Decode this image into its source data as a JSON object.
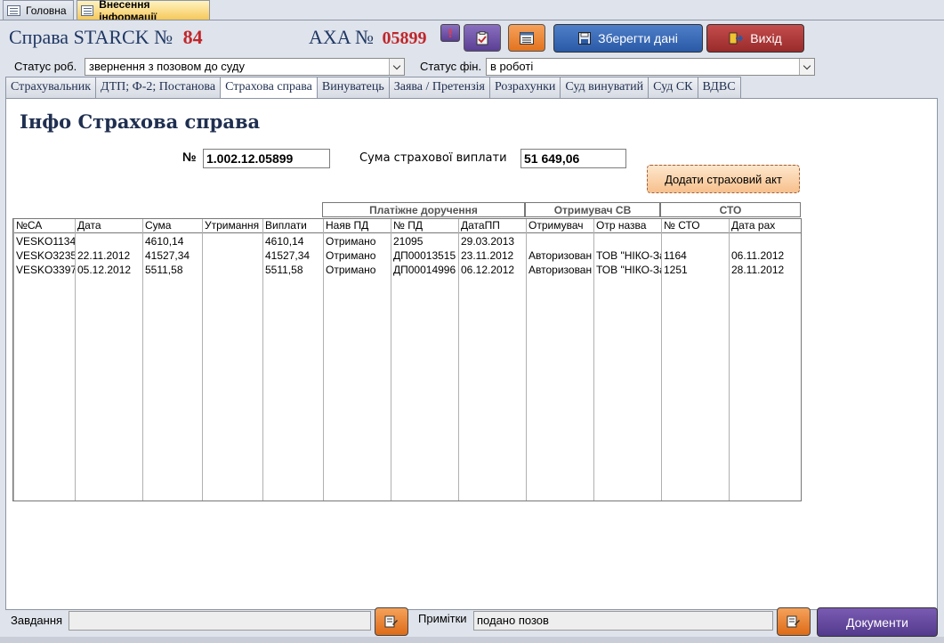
{
  "doc_tabs": [
    "Головна",
    "Внесення інформації"
  ],
  "header": {
    "case_label": "Справа STARCK №",
    "case_number": "84",
    "axa_label": "AXA №",
    "axa_number": "05899",
    "excl_label": "!",
    "save_label": "Зберегти дані",
    "exit_label": "Вихід"
  },
  "status": {
    "work_label": "Статус роб.",
    "work_value": "звернення з позовом до суду",
    "fin_label": "Статус фін.",
    "fin_value": "в роботі"
  },
  "tabs": [
    "Страхувальник",
    "ДТП; Ф-2; Постанова",
    "Страхова справа",
    "Винуватець",
    "Заява / Претензія",
    "Розрахунки",
    "Суд винуватий",
    "Суд СК",
    "ВДВС"
  ],
  "active_tab": "Страхова справа",
  "page": {
    "title": "Інфо Страхова справа",
    "num_label": "№",
    "num_value": "1.002.12.05899",
    "sum_label": "Сума страхової виплати",
    "sum_value": "51 649,06",
    "add_act_label": "Додати страховий акт"
  },
  "groups": {
    "payment": "Платіжне доручення",
    "recipient": "Отримувач СВ",
    "sto": "СТО"
  },
  "table": {
    "columns": [
      "№СА",
      "Дата",
      "Сума",
      "Утримання",
      "Виплати",
      "Наяв ПД",
      "№ ПД",
      "ДатаПП",
      "Отримувач",
      "Отр назва",
      "№ СТО",
      "Дата рах"
    ],
    "rows": [
      [
        "VESKO1134",
        "",
        "4610,14",
        "",
        "4610,14",
        "Отримано",
        "21095",
        "29.03.2013",
        "",
        "",
        "",
        ""
      ],
      [
        "VESKO3235",
        "22.11.2012",
        "41527,34",
        "",
        "41527,34",
        "Отримано",
        "ДП00013515",
        "23.11.2012",
        "Авторизован",
        "ТОВ \"НІКО-За",
        "1164",
        "06.11.2012"
      ],
      [
        "VESKO3397",
        "05.12.2012",
        "5511,58",
        "",
        "5511,58",
        "Отримано",
        "ДП00014996",
        "06.12.2012",
        "Авторизован",
        "ТОВ \"НІКО-За",
        "1251",
        "28.11.2012"
      ]
    ]
  },
  "bottom": {
    "tasks_label": "Завдання",
    "tasks_value": "",
    "notes_label": "Примітки",
    "notes_value": "подано позов",
    "docs_label": "Документи"
  }
}
